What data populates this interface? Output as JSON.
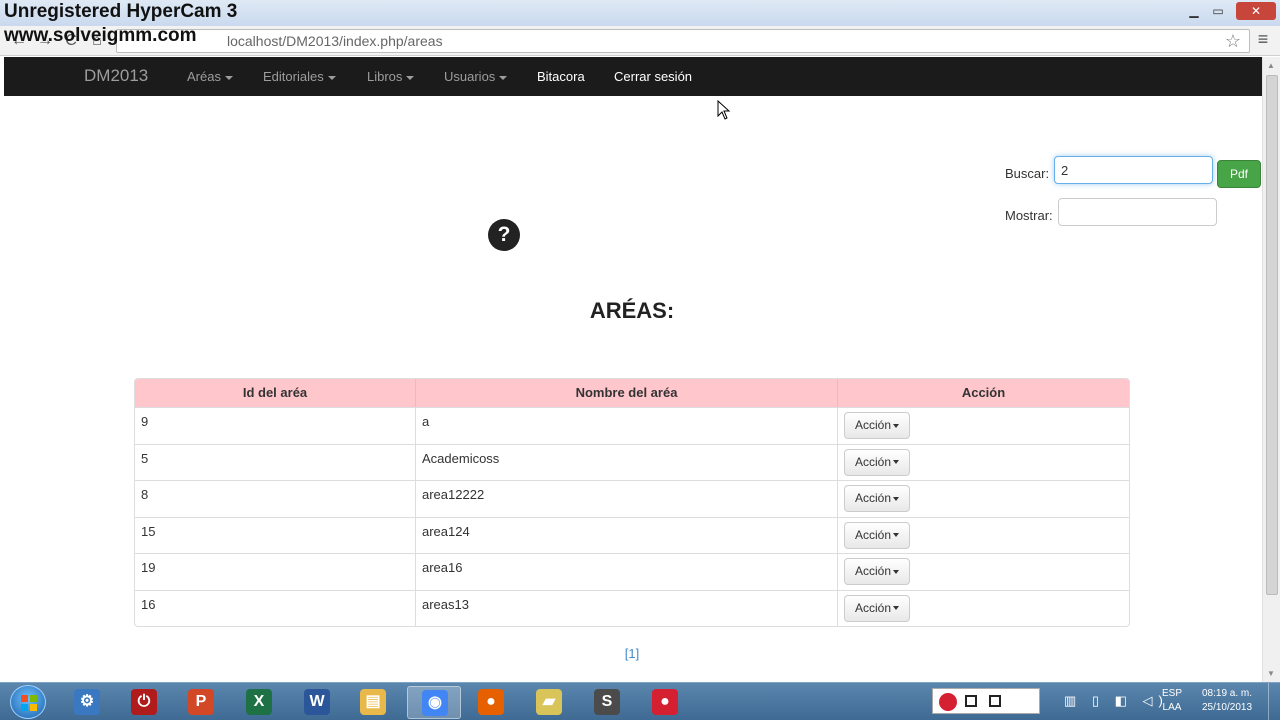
{
  "watermark": {
    "line1": "Unregistered HyperCam 3",
    "line2": "www.solveigmm.com"
  },
  "browser": {
    "url": "localhost/DM2013/index.php/areas",
    "buttons": {
      "back": "←",
      "forward": "→",
      "reload": "C",
      "home": "⌂",
      "star": "☆",
      "menu": "≡"
    },
    "window_controls": {
      "minimize": "▁",
      "maximize": "▭",
      "close": "✕"
    }
  },
  "navbar": {
    "brand": "DM2013",
    "items": [
      {
        "label": "Aréas",
        "dropdown": true
      },
      {
        "label": "Editoriales",
        "dropdown": true
      },
      {
        "label": "Libros",
        "dropdown": true
      },
      {
        "label": "Usuarios",
        "dropdown": true
      },
      {
        "label": "Bitacora",
        "dropdown": false
      },
      {
        "label": "Cerrar sesión",
        "dropdown": false
      }
    ]
  },
  "search": {
    "label": "Buscar:",
    "value": "2",
    "pdf_label": "Pdf",
    "show_label": "Mostrar:",
    "show_value": ""
  },
  "help_icon": "?",
  "page_title": "ARÉAS:",
  "table": {
    "headers": [
      "Id del aréa",
      "Nombre del aréa",
      "Acción"
    ],
    "rows": [
      {
        "id": "9",
        "name": "a",
        "action": "Acción"
      },
      {
        "id": "5",
        "name": "Academicoss",
        "action": "Acción"
      },
      {
        "id": "8",
        "name": "area12222",
        "action": "Acción"
      },
      {
        "id": "15",
        "name": "area124",
        "action": "Acción"
      },
      {
        "id": "19",
        "name": "area16",
        "action": "Acción"
      },
      {
        "id": "16",
        "name": "areas13",
        "action": "Acción"
      }
    ]
  },
  "pagination": "[1]",
  "taskbar": {
    "apps": [
      {
        "name": "control-panel",
        "glyph": "⚙",
        "color": "#3a78c2"
      },
      {
        "name": "shutdown",
        "glyph": "⏻",
        "color": "#b01b1b"
      },
      {
        "name": "powerpoint",
        "glyph": "P",
        "color": "#d24726"
      },
      {
        "name": "excel",
        "glyph": "X",
        "color": "#1e7145"
      },
      {
        "name": "word",
        "glyph": "W",
        "color": "#2b579a"
      },
      {
        "name": "explorer",
        "glyph": "▤",
        "color": "#e8b84a"
      },
      {
        "name": "chrome",
        "glyph": "◉",
        "color": "#4285f4"
      },
      {
        "name": "firefox",
        "glyph": "●",
        "color": "#e66000"
      },
      {
        "name": "folder",
        "glyph": "▰",
        "color": "#d9c45a"
      },
      {
        "name": "sublime",
        "glyph": "S",
        "color": "#4b4b4b"
      },
      {
        "name": "hypercam",
        "glyph": "●",
        "color": "#d42030"
      }
    ],
    "tray_icons": "▥ ▯ ◧ ◁)",
    "language": [
      "ESP",
      "LAA"
    ],
    "time": "08:19 a. m.",
    "date": "25/10/2013"
  },
  "colors": {
    "navbar_bg": "#1b1b1b",
    "table_header_bg": "#ffc6cc",
    "pdf_button": "#47a447",
    "link": "#428bca"
  }
}
